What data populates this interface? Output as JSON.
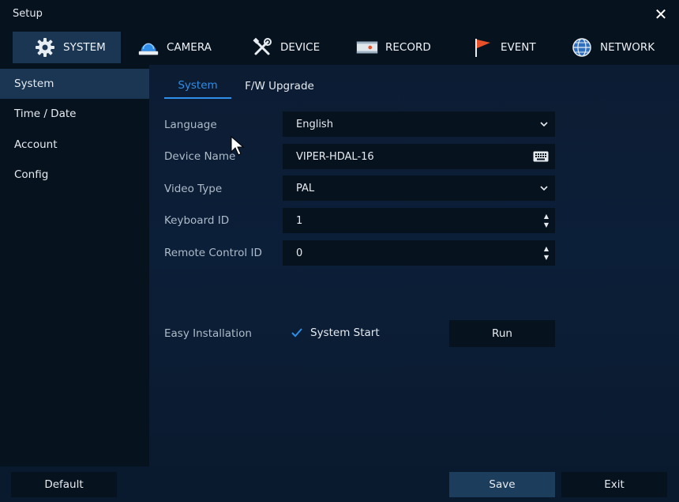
{
  "window": {
    "title": "Setup"
  },
  "topnav": {
    "tabs": [
      {
        "label": "SYSTEM",
        "icon": "gear-icon",
        "active": true
      },
      {
        "label": "CAMERA",
        "icon": "camera-icon",
        "active": false
      },
      {
        "label": "DEVICE",
        "icon": "tools-icon",
        "active": false
      },
      {
        "label": "RECORD",
        "icon": "record-icon",
        "active": false
      },
      {
        "label": "EVENT",
        "icon": "flag-icon",
        "active": false
      },
      {
        "label": "NETWORK",
        "icon": "globe-icon",
        "active": false
      }
    ]
  },
  "sidebar": {
    "items": [
      {
        "label": "System",
        "active": true
      },
      {
        "label": "Time / Date",
        "active": false
      },
      {
        "label": "Account",
        "active": false
      },
      {
        "label": "Config",
        "active": false
      }
    ]
  },
  "subtabs": [
    {
      "label": "System",
      "active": true
    },
    {
      "label": "F/W Upgrade",
      "active": false
    }
  ],
  "form": {
    "language": {
      "label": "Language",
      "value": "English"
    },
    "device_name": {
      "label": "Device Name",
      "value": "VIPER-HDAL-16"
    },
    "video_type": {
      "label": "Video Type",
      "value": "PAL"
    },
    "keyboard_id": {
      "label": "Keyboard ID",
      "value": "1"
    },
    "remote_control_id": {
      "label": "Remote Control ID",
      "value": "0"
    },
    "easy_installation": {
      "label": "Easy Installation",
      "checkbox_label": "System Start",
      "checked": true,
      "run_label": "Run"
    }
  },
  "footer": {
    "default_label": "Default",
    "save_label": "Save",
    "exit_label": "Exit"
  },
  "colors": {
    "accent": "#2e8ee8",
    "panel": "#07121f",
    "active": "#1a3652",
    "flag": "#e8502a"
  }
}
